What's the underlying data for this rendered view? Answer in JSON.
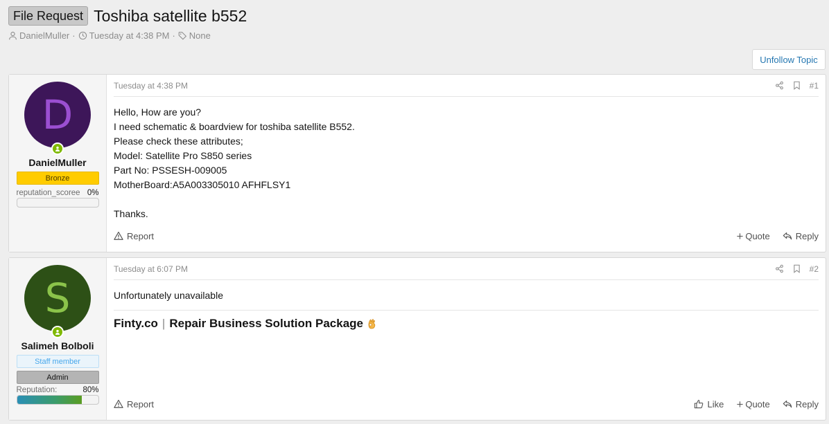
{
  "thread": {
    "prefix": "File Request",
    "title": "Toshiba satellite b552",
    "author": "DanielMuller",
    "date": "Tuesday at 4:38 PM",
    "tags": "None",
    "meta_sep": "·"
  },
  "actions": {
    "unfollow": "Unfollow Topic"
  },
  "posts": [
    {
      "avatar_letter": "D",
      "avatar_bg": "#3d1659",
      "avatar_fg": "#9b4fd1",
      "username": "DanielMuller",
      "banners": [
        "Bronze"
      ],
      "rep_label": "reputation_scoree",
      "rep_value": "0%",
      "rep_fraction": 0.0,
      "date": "Tuesday at 4:38 PM",
      "number": "#1",
      "body": [
        "Hello, How are you?",
        "I need schematic & boardview for toshiba satellite B552.",
        "Please check these attributes;",
        "Model: Satellite Pro S850 series",
        "Part No: PSSESH-009005",
        "MotherBoard:A5A003305010 AFHFLSY1",
        "",
        "Thanks."
      ],
      "report": "Report",
      "quote": "Quote",
      "reply": "Reply"
    },
    {
      "avatar_letter": "S",
      "avatar_bg": "#2d5016",
      "avatar_fg": "#8bc34a",
      "username": "Salimeh Bolboli",
      "banners": [
        "Staff member",
        "Admin"
      ],
      "rep_label": "Reputation:",
      "rep_value": "80%",
      "rep_fraction": 0.8,
      "date": "Tuesday at 6:07 PM",
      "number": "#2",
      "body": [
        "Unfortunately unavailable"
      ],
      "signature": {
        "site": "Finty.co",
        "sep": "|",
        "text": "Repair Business Solution Package"
      },
      "report": "Report",
      "like": "Like",
      "quote": "Quote",
      "reply": "Reply"
    }
  ],
  "colors": {
    "link": "#2577b1",
    "online": "#7fb900",
    "bronze": "#ffcc00"
  },
  "icons": [
    "user-icon",
    "clock-icon",
    "tag-icon",
    "share-icon",
    "bookmark-icon",
    "warning-icon",
    "plus-icon",
    "reply-icon",
    "thumbs-up-icon",
    "ok-hand-emoji"
  ]
}
